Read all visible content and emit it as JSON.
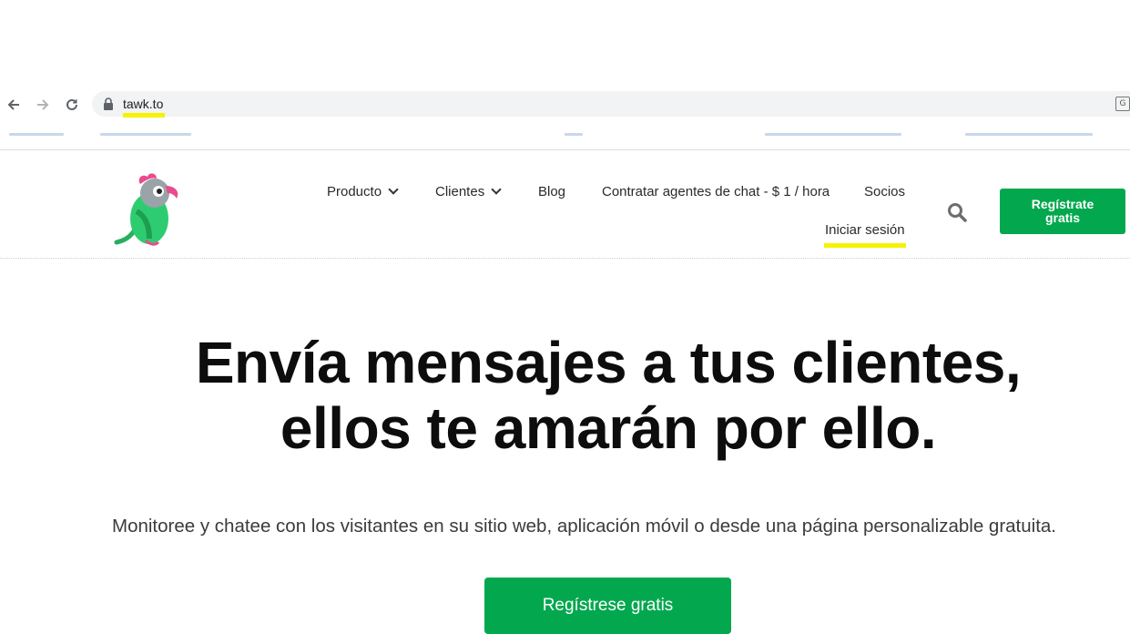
{
  "browser": {
    "url": "tawk.to",
    "icons": {
      "back": "arrow-left-icon",
      "forward": "arrow-right-icon",
      "reload": "reload-icon",
      "lock": "lock-icon",
      "translate": "translate-icon"
    }
  },
  "site": {
    "brand_color": "#03a84e",
    "highlight_color": "#f6f200",
    "nav": [
      {
        "label": "Producto",
        "dropdown": true
      },
      {
        "label": "Clientes",
        "dropdown": true
      },
      {
        "label": "Blog",
        "dropdown": false
      },
      {
        "label": "Contratar agentes de chat - $ 1 / hora",
        "dropdown": false
      },
      {
        "label": "Socios",
        "dropdown": false
      }
    ],
    "login_label": "Iniciar sesión",
    "register_button": "Regístrate gratis"
  },
  "hero": {
    "title_line1": "Envía mensajes a tus clientes,",
    "title_line2": "ellos te amarán por ello.",
    "subtitle": "Monitoree y chatee con los visitantes en su sitio web, aplicación móvil o desde una página personalizable gratuita.",
    "cta": "Regístrese gratis"
  }
}
